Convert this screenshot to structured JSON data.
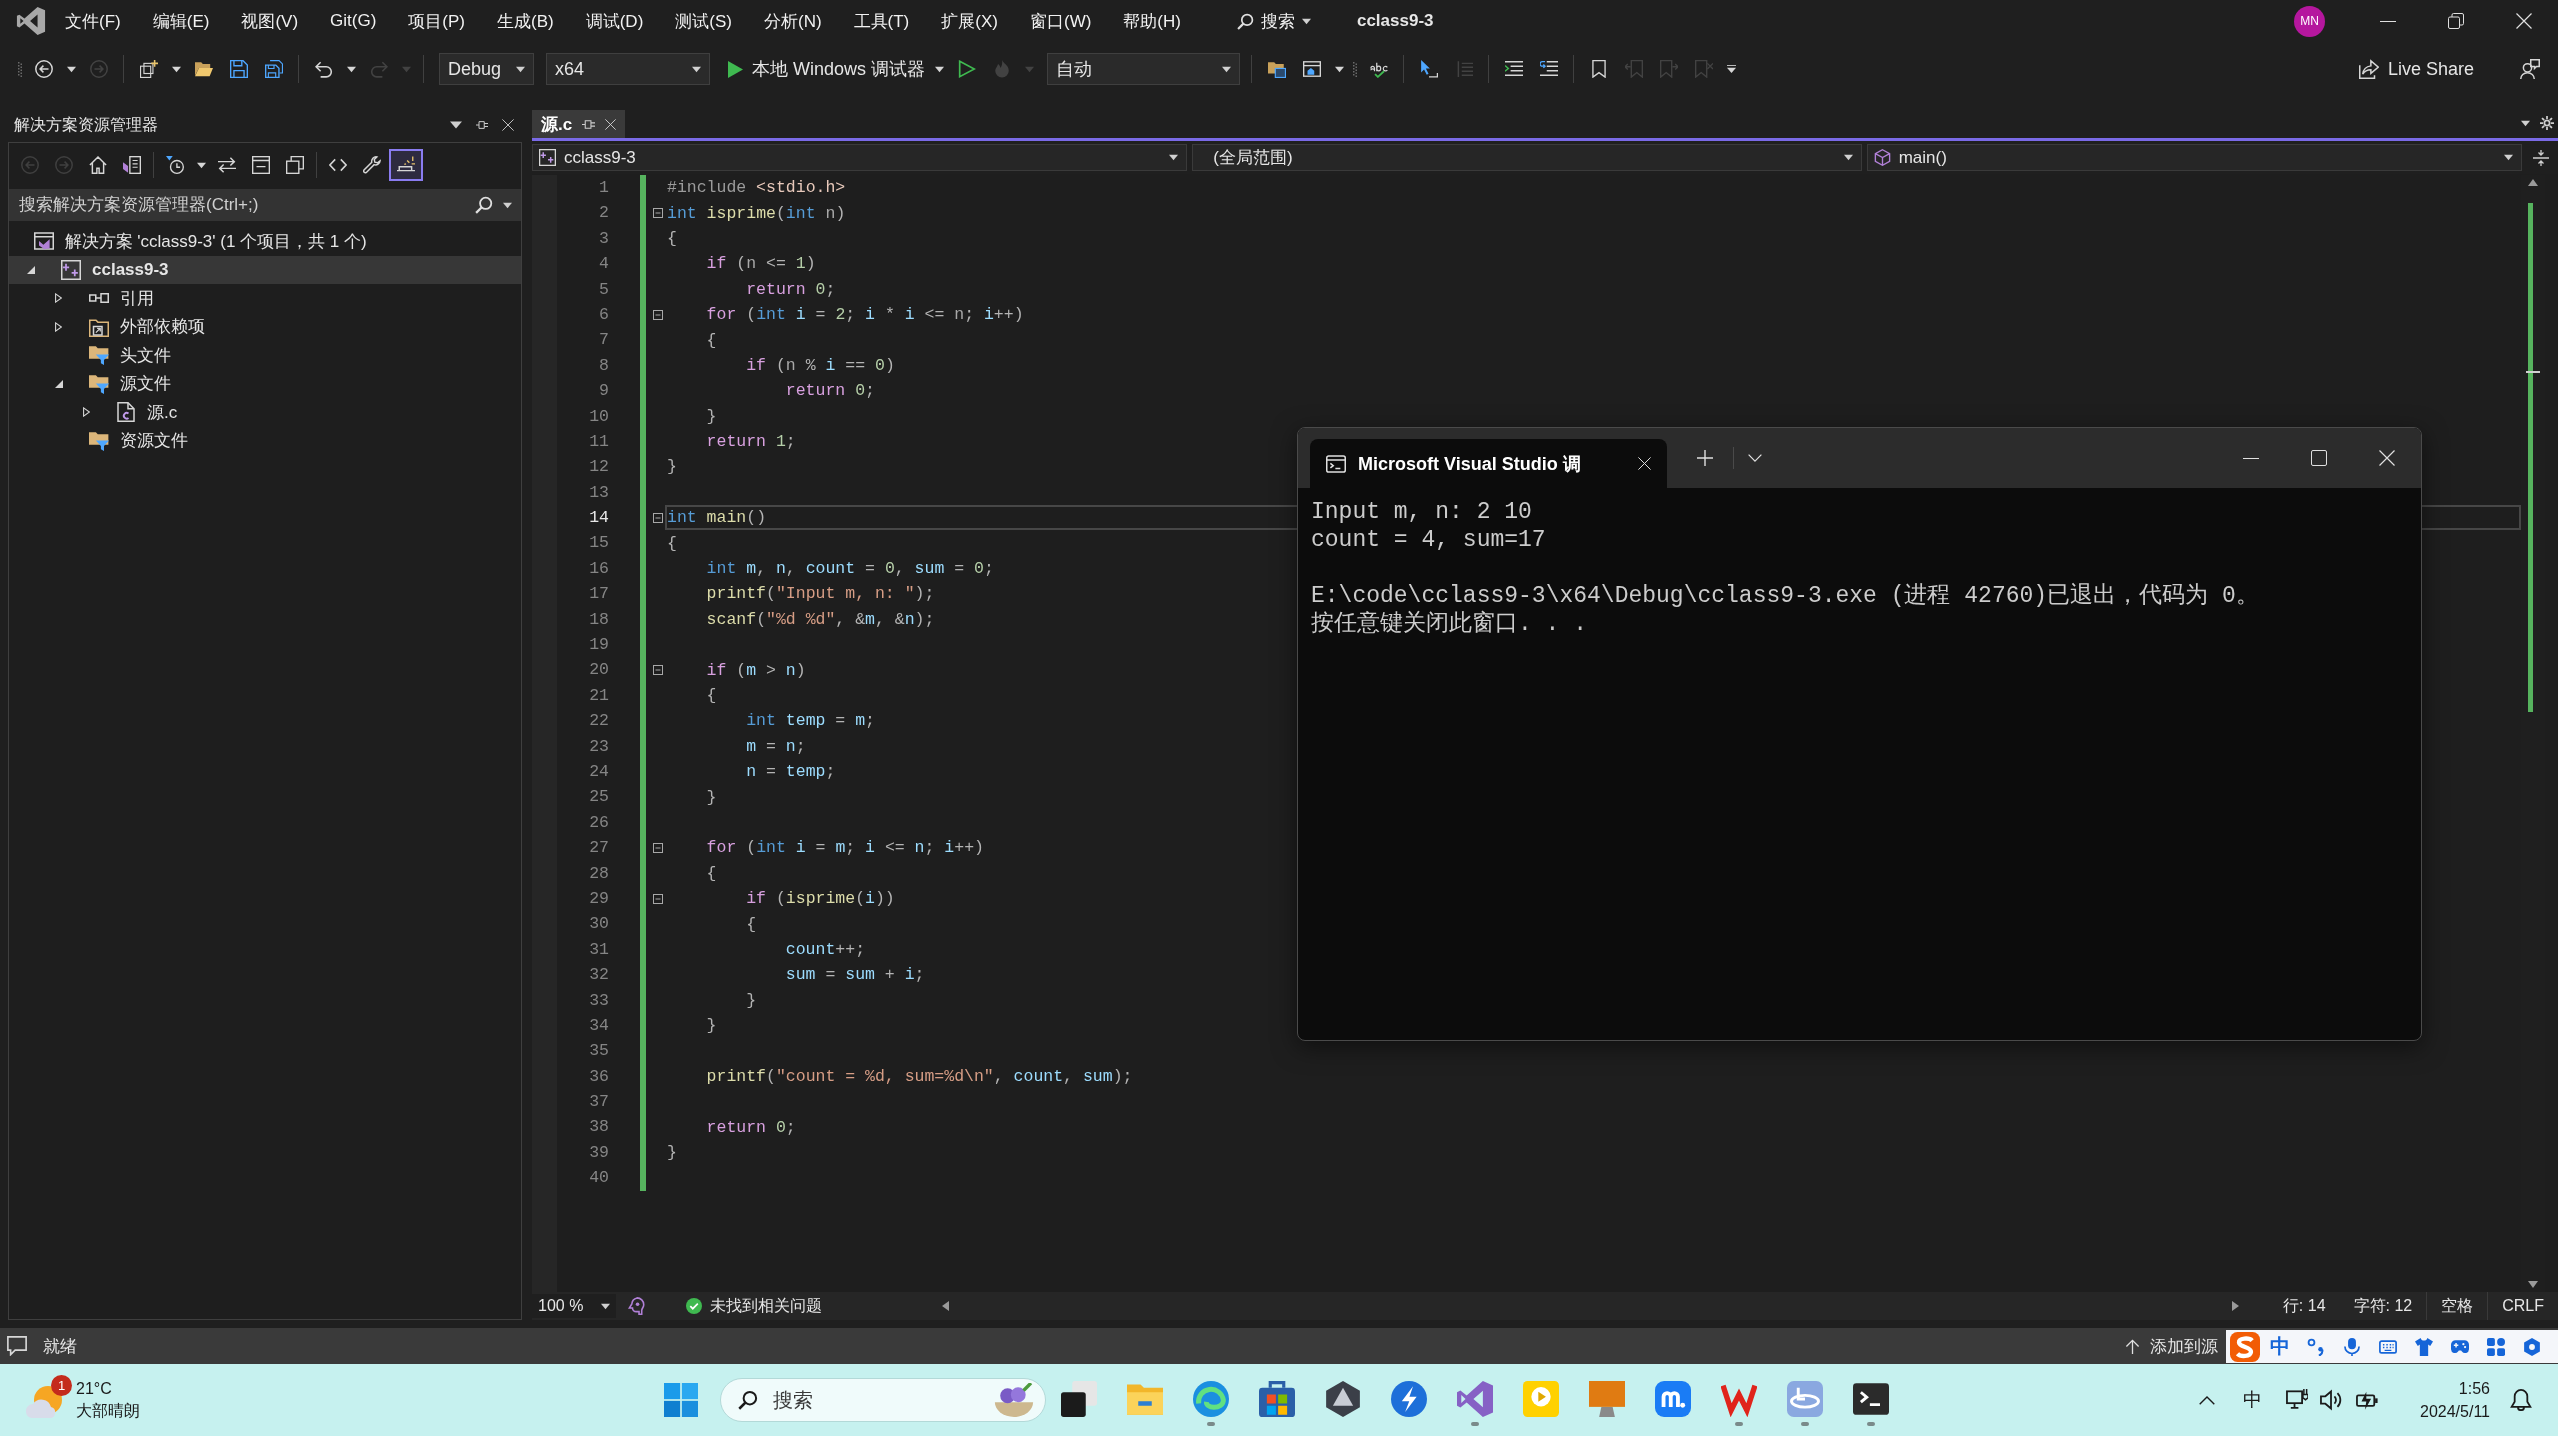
{
  "menu_bar": {
    "items": [
      "文件(F)",
      "编辑(E)",
      "视图(V)",
      "Git(G)",
      "项目(P)",
      "生成(B)",
      "调试(D)",
      "测试(S)",
      "分析(N)",
      "工具(T)",
      "扩展(X)",
      "窗口(W)",
      "帮助(H)"
    ],
    "search": "搜索",
    "solution": "cclass9-3",
    "account": "MN"
  },
  "toolbar": {
    "groups": [
      {
        "items": [
          {
            "kind": "grip",
            "disabled": false
          },
          {
            "kind": "back",
            "disabled": false
          },
          {
            "kind": "dropdown",
            "disabled": false
          },
          {
            "kind": "forward",
            "disabled": true
          }
        ]
      },
      {
        "items": [
          {
            "kind": "new-item",
            "disabled": false
          },
          {
            "kind": "dropdown",
            "disabled": false
          },
          {
            "kind": "open",
            "disabled": false
          },
          {
            "kind": "save",
            "disabled": false
          },
          {
            "kind": "save-all",
            "disabled": false
          }
        ]
      },
      {
        "items": [
          {
            "kind": "undo",
            "disabled": false
          },
          {
            "kind": "dropdown",
            "disabled": false
          },
          {
            "kind": "redo",
            "disabled": true
          },
          {
            "kind": "dropdown",
            "disabled": true
          }
        ]
      },
      {
        "items": [
          {
            "kind": "configuration-select",
            "value": "Debug",
            "disabled": false
          },
          {
            "kind": "platform-select",
            "value": "x64",
            "disabled": false
          },
          {
            "kind": "run",
            "label": "本地 Windows 调试器",
            "disabled": false
          },
          {
            "kind": "dropdown",
            "disabled": false
          },
          {
            "kind": "run-outline",
            "disabled": false
          },
          {
            "kind": "hot-reload",
            "disabled": true
          },
          {
            "kind": "dropdown",
            "disabled": true
          },
          {
            "kind": "mode-select",
            "value": "自动",
            "disabled": false
          }
        ]
      },
      {
        "items": [
          {
            "kind": "browse",
            "disabled": false
          },
          {
            "kind": "window",
            "disabled": false
          },
          {
            "kind": "dropdown",
            "disabled": false
          },
          {
            "kind": "grip",
            "disabled": false
          },
          {
            "kind": "spellcheck",
            "disabled": false
          }
        ]
      },
      {
        "items": [
          {
            "kind": "cursor",
            "disabled": false
          },
          {
            "kind": "column",
            "disabled": true
          }
        ]
      },
      {
        "items": [
          {
            "kind": "comment",
            "disabled": false
          },
          {
            "kind": "uncomment",
            "disabled": false
          }
        ]
      },
      {
        "items": [
          {
            "kind": "bookmark",
            "disabled": false
          },
          {
            "kind": "bookmark-prev",
            "disabled": true
          },
          {
            "kind": "bookmark-next",
            "disabled": true
          },
          {
            "kind": "bookmark-clear",
            "disabled": true
          },
          {
            "kind": "overflow",
            "disabled": false
          }
        ]
      }
    ],
    "live_share": "Live Share"
  },
  "solution_explorer": {
    "title": "解决方案资源管理器",
    "toolbar": {
      "groups": [
        {
          "items": [
            {
              "kind": "back",
              "disabled": true,
              "on": false
            },
            {
              "kind": "forward",
              "disabled": true,
              "on": false
            },
            {
              "kind": "home",
              "disabled": false,
              "on": false
            },
            {
              "kind": "switch-views",
              "disabled": false,
              "on": false
            }
          ]
        },
        {
          "items": [
            {
              "kind": "pending-changes",
              "disabled": false,
              "on": false
            },
            {
              "kind": "dropdown",
              "disabled": false,
              "on": false
            },
            {
              "kind": "sync",
              "disabled": false,
              "on": false
            },
            {
              "kind": "collapse-all",
              "disabled": false,
              "on": false
            },
            {
              "kind": "show-all",
              "disabled": false,
              "on": false
            }
          ]
        },
        {
          "items": [
            {
              "kind": "code",
              "disabled": false,
              "on": false
            },
            {
              "kind": "properties",
              "disabled": false,
              "on": false
            },
            {
              "kind": "preview",
              "disabled": false,
              "on": true
            }
          ]
        }
      ]
    },
    "search": {
      "placeholder": "搜索解决方案资源管理器(Ctrl+;)"
    },
    "tree": [
      {
        "label": "解决方案 'cclass9-3' (1 个项目，共 1 个)",
        "kind": "solution",
        "selected": false,
        "children": [
          {
            "label": "cclass9-3",
            "kind": "project",
            "expanded": true,
            "selected": true,
            "children": [
              {
                "label": "引用",
                "kind": "references",
                "expanded": false,
                "selected": false
              },
              {
                "label": "外部依赖项",
                "kind": "dependencies",
                "expanded": false,
                "selected": false
              },
              {
                "label": "头文件",
                "kind": "filter",
                "selected": false
              },
              {
                "label": "源文件",
                "kind": "filter",
                "expanded": true,
                "selected": false,
                "children": [
                  {
                    "label": "源.c",
                    "kind": "c-file",
                    "expanded": false,
                    "selected": false
                  }
                ]
              },
              {
                "label": "资源文件",
                "kind": "filter",
                "selected": false
              }
            ]
          }
        ]
      }
    ]
  },
  "editor": {
    "tabs": [
      {
        "label": "源.c",
        "selected": true
      }
    ],
    "navigation": {
      "project": "cclass9-3",
      "scope": "(全局范围)",
      "member": "main()"
    },
    "lines": [
      {
        "number": "1",
        "changed": true,
        "fold": false,
        "selected": false,
        "tokens": [
          {
            "kind": "preproc",
            "text": "#include"
          },
          {
            "kind": "include",
            "text": " <stdio.h>"
          }
        ]
      },
      {
        "number": "2",
        "changed": true,
        "fold": true,
        "selected": false,
        "tokens": [
          {
            "kind": "keyword",
            "text": "int"
          },
          {
            "kind": "function",
            "text": " isprime"
          },
          {
            "kind": "punct",
            "text": "("
          },
          {
            "kind": "keyword",
            "text": "int"
          },
          {
            "kind": "param",
            "text": " n"
          },
          {
            "kind": "punct",
            "text": ")"
          }
        ]
      },
      {
        "number": "3",
        "changed": true,
        "fold": false,
        "selected": false,
        "tokens": [
          {
            "kind": "punct",
            "text": "{"
          }
        ]
      },
      {
        "number": "4",
        "changed": true,
        "fold": false,
        "selected": false,
        "tokens": [
          {
            "kind": "control",
            "text": "    if"
          },
          {
            "kind": "punct",
            "text": " ("
          },
          {
            "kind": "param",
            "text": "n"
          },
          {
            "kind": "punct",
            "text": " <= "
          },
          {
            "kind": "number",
            "text": "1"
          },
          {
            "kind": "punct",
            "text": ")"
          }
        ]
      },
      {
        "number": "5",
        "changed": true,
        "fold": false,
        "selected": false,
        "tokens": [
          {
            "kind": "control",
            "text": "        return"
          },
          {
            "kind": "number",
            "text": " 0"
          },
          {
            "kind": "punct",
            "text": ";"
          }
        ]
      },
      {
        "number": "6",
        "changed": true,
        "fold": true,
        "selected": false,
        "tokens": [
          {
            "kind": "control",
            "text": "    for"
          },
          {
            "kind": "punct",
            "text": " ("
          },
          {
            "kind": "keyword",
            "text": "int"
          },
          {
            "kind": "local",
            "text": " i"
          },
          {
            "kind": "punct",
            "text": " = "
          },
          {
            "kind": "number",
            "text": "2"
          },
          {
            "kind": "punct",
            "text": "; "
          },
          {
            "kind": "local",
            "text": "i"
          },
          {
            "kind": "punct",
            "text": " * "
          },
          {
            "kind": "local",
            "text": "i"
          },
          {
            "kind": "punct",
            "text": " <= "
          },
          {
            "kind": "param",
            "text": "n"
          },
          {
            "kind": "punct",
            "text": "; "
          },
          {
            "kind": "local",
            "text": "i"
          },
          {
            "kind": "punct",
            "text": "++)"
          }
        ]
      },
      {
        "number": "7",
        "changed": true,
        "fold": false,
        "selected": false,
        "tokens": [
          {
            "kind": "punct",
            "text": "    {"
          }
        ]
      },
      {
        "number": "8",
        "changed": true,
        "fold": false,
        "selected": false,
        "tokens": [
          {
            "kind": "control",
            "text": "        if"
          },
          {
            "kind": "punct",
            "text": " ("
          },
          {
            "kind": "param",
            "text": "n"
          },
          {
            "kind": "punct",
            "text": " % "
          },
          {
            "kind": "local",
            "text": "i"
          },
          {
            "kind": "punct",
            "text": " == "
          },
          {
            "kind": "number",
            "text": "0"
          },
          {
            "kind": "punct",
            "text": ")"
          }
        ]
      },
      {
        "number": "9",
        "changed": true,
        "fold": false,
        "selected": false,
        "tokens": [
          {
            "kind": "control",
            "text": "            return"
          },
          {
            "kind": "number",
            "text": " 0"
          },
          {
            "kind": "punct",
            "text": ";"
          }
        ]
      },
      {
        "number": "10",
        "changed": true,
        "fold": false,
        "selected": false,
        "tokens": [
          {
            "kind": "punct",
            "text": "    }"
          }
        ]
      },
      {
        "number": "11",
        "changed": true,
        "fold": false,
        "selected": false,
        "tokens": [
          {
            "kind": "control",
            "text": "    return"
          },
          {
            "kind": "number",
            "text": " 1"
          },
          {
            "kind": "punct",
            "text": ";"
          }
        ]
      },
      {
        "number": "12",
        "changed": true,
        "fold": false,
        "selected": false,
        "tokens": [
          {
            "kind": "punct",
            "text": "}"
          }
        ]
      },
      {
        "number": "13",
        "changed": true,
        "fold": false,
        "selected": false
      },
      {
        "number": "14",
        "changed": true,
        "fold": true,
        "selected": true,
        "tokens": [
          {
            "kind": "keyword",
            "text": "int"
          },
          {
            "kind": "function",
            "text": " main"
          },
          {
            "kind": "punct",
            "text": "()"
          }
        ]
      },
      {
        "number": "15",
        "changed": true,
        "fold": false,
        "selected": false,
        "tokens": [
          {
            "kind": "punct",
            "text": "{"
          }
        ]
      },
      {
        "number": "16",
        "changed": true,
        "fold": false,
        "selected": false,
        "tokens": [
          {
            "kind": "keyword",
            "text": "    int"
          },
          {
            "kind": "local",
            "text": " m"
          },
          {
            "kind": "punct",
            "text": ", "
          },
          {
            "kind": "local",
            "text": "n"
          },
          {
            "kind": "punct",
            "text": ", "
          },
          {
            "kind": "local",
            "text": "count"
          },
          {
            "kind": "punct",
            "text": " = "
          },
          {
            "kind": "number",
            "text": "0"
          },
          {
            "kind": "punct",
            "text": ", "
          },
          {
            "kind": "local",
            "text": "sum"
          },
          {
            "kind": "punct",
            "text": " = "
          },
          {
            "kind": "number",
            "text": "0"
          },
          {
            "kind": "punct",
            "text": ";"
          }
        ]
      },
      {
        "number": "17",
        "changed": true,
        "fold": false,
        "selected": false,
        "tokens": [
          {
            "kind": "function",
            "text": "    printf"
          },
          {
            "kind": "punct",
            "text": "("
          },
          {
            "kind": "string",
            "text": "\"Input m, n: \""
          },
          {
            "kind": "punct",
            "text": ");"
          }
        ]
      },
      {
        "number": "18",
        "changed": true,
        "fold": false,
        "selected": false,
        "tokens": [
          {
            "kind": "function",
            "text": "    scanf"
          },
          {
            "kind": "punct",
            "text": "("
          },
          {
            "kind": "string",
            "text": "\"%d %d\""
          },
          {
            "kind": "punct",
            "text": ", &"
          },
          {
            "kind": "local",
            "text": "m"
          },
          {
            "kind": "punct",
            "text": ", &"
          },
          {
            "kind": "local",
            "text": "n"
          },
          {
            "kind": "punct",
            "text": ");"
          }
        ]
      },
      {
        "number": "19",
        "changed": true,
        "fold": false,
        "selected": false
      },
      {
        "number": "20",
        "changed": true,
        "fold": true,
        "selected": false,
        "tokens": [
          {
            "kind": "control",
            "text": "    if"
          },
          {
            "kind": "punct",
            "text": " ("
          },
          {
            "kind": "local",
            "text": "m"
          },
          {
            "kind": "punct",
            "text": " > "
          },
          {
            "kind": "local",
            "text": "n"
          },
          {
            "kind": "punct",
            "text": ")"
          }
        ]
      },
      {
        "number": "21",
        "changed": true,
        "fold": false,
        "selected": false,
        "tokens": [
          {
            "kind": "punct",
            "text": "    {"
          }
        ]
      },
      {
        "number": "22",
        "changed": true,
        "fold": false,
        "selected": false,
        "tokens": [
          {
            "kind": "keyword",
            "text": "        int"
          },
          {
            "kind": "local",
            "text": " temp"
          },
          {
            "kind": "punct",
            "text": " = "
          },
          {
            "kind": "local",
            "text": "m"
          },
          {
            "kind": "punct",
            "text": ";"
          }
        ]
      },
      {
        "number": "23",
        "changed": true,
        "fold": false,
        "selected": false,
        "tokens": [
          {
            "kind": "local",
            "text": "        m"
          },
          {
            "kind": "punct",
            "text": " = "
          },
          {
            "kind": "local",
            "text": "n"
          },
          {
            "kind": "punct",
            "text": ";"
          }
        ]
      },
      {
        "number": "24",
        "changed": true,
        "fold": false,
        "selected": false,
        "tokens": [
          {
            "kind": "local",
            "text": "        n"
          },
          {
            "kind": "punct",
            "text": " = "
          },
          {
            "kind": "local",
            "text": "temp"
          },
          {
            "kind": "punct",
            "text": ";"
          }
        ]
      },
      {
        "number": "25",
        "changed": true,
        "fold": false,
        "selected": false,
        "tokens": [
          {
            "kind": "punct",
            "text": "    }"
          }
        ]
      },
      {
        "number": "26",
        "changed": true,
        "fold": false,
        "selected": false
      },
      {
        "number": "27",
        "changed": true,
        "fold": true,
        "selected": false,
        "tokens": [
          {
            "kind": "control",
            "text": "    for"
          },
          {
            "kind": "punct",
            "text": " ("
          },
          {
            "kind": "keyword",
            "text": "int"
          },
          {
            "kind": "local",
            "text": " i"
          },
          {
            "kind": "punct",
            "text": " = "
          },
          {
            "kind": "local",
            "text": "m"
          },
          {
            "kind": "punct",
            "text": "; "
          },
          {
            "kind": "local",
            "text": "i"
          },
          {
            "kind": "punct",
            "text": " <= "
          },
          {
            "kind": "local",
            "text": "n"
          },
          {
            "kind": "punct",
            "text": "; "
          },
          {
            "kind": "local",
            "text": "i"
          },
          {
            "kind": "punct",
            "text": "++)"
          }
        ]
      },
      {
        "number": "28",
        "changed": true,
        "fold": false,
        "selected": false,
        "tokens": [
          {
            "kind": "punct",
            "text": "    {"
          }
        ]
      },
      {
        "number": "29",
        "changed": true,
        "fold": true,
        "selected": false,
        "tokens": [
          {
            "kind": "control",
            "text": "        if"
          },
          {
            "kind": "punct",
            "text": " ("
          },
          {
            "kind": "function",
            "text": "isprime"
          },
          {
            "kind": "punct",
            "text": "("
          },
          {
            "kind": "local",
            "text": "i"
          },
          {
            "kind": "punct",
            "text": "))"
          }
        ]
      },
      {
        "number": "30",
        "changed": true,
        "fold": false,
        "selected": false,
        "tokens": [
          {
            "kind": "punct",
            "text": "        {"
          }
        ]
      },
      {
        "number": "31",
        "changed": true,
        "fold": false,
        "selected": false,
        "tokens": [
          {
            "kind": "local",
            "text": "            count"
          },
          {
            "kind": "punct",
            "text": "++;"
          }
        ]
      },
      {
        "number": "32",
        "changed": true,
        "fold": false,
        "selected": false,
        "tokens": [
          {
            "kind": "local",
            "text": "            sum"
          },
          {
            "kind": "punct",
            "text": " = "
          },
          {
            "kind": "local",
            "text": "sum"
          },
          {
            "kind": "punct",
            "text": " + "
          },
          {
            "kind": "local",
            "text": "i"
          },
          {
            "kind": "punct",
            "text": ";"
          }
        ]
      },
      {
        "number": "33",
        "changed": true,
        "fold": false,
        "selected": false,
        "tokens": [
          {
            "kind": "punct",
            "text": "        }"
          }
        ]
      },
      {
        "number": "34",
        "changed": true,
        "fold": false,
        "selected": false,
        "tokens": [
          {
            "kind": "punct",
            "text": "    }"
          }
        ]
      },
      {
        "number": "35",
        "changed": true,
        "fold": false,
        "selected": false
      },
      {
        "number": "36",
        "changed": true,
        "fold": false,
        "selected": false,
        "tokens": [
          {
            "kind": "function",
            "text": "    printf"
          },
          {
            "kind": "punct",
            "text": "("
          },
          {
            "kind": "string",
            "text": "\"count = %d, sum=%d\\n\""
          },
          {
            "kind": "punct",
            "text": ", "
          },
          {
            "kind": "local",
            "text": "count"
          },
          {
            "kind": "punct",
            "text": ", "
          },
          {
            "kind": "local",
            "text": "sum"
          },
          {
            "kind": "punct",
            "text": ");"
          }
        ]
      },
      {
        "number": "37",
        "changed": true,
        "fold": false,
        "selected": false
      },
      {
        "number": "38",
        "changed": true,
        "fold": false,
        "selected": false,
        "tokens": [
          {
            "kind": "control",
            "text": "    return"
          },
          {
            "kind": "number",
            "text": " 0"
          },
          {
            "kind": "punct",
            "text": ";"
          }
        ]
      },
      {
        "number": "39",
        "changed": true,
        "fold": false,
        "selected": false,
        "tokens": [
          {
            "kind": "punct",
            "text": "}"
          }
        ]
      },
      {
        "number": "40",
        "changed": true,
        "fold": false,
        "selected": false
      }
    ],
    "status": {
      "zoom": "100 %",
      "issues": "未找到相关问题",
      "line": "行: 14",
      "column": "字符: 12",
      "indentation": "空格",
      "line_ending": "CRLF"
    }
  },
  "console": {
    "title": "Microsoft Visual Studio 调",
    "output": [
      {
        "lines": [
          "Input m, n: 2 10",
          "count = 4, sum=17"
        ]
      },
      {
        "lines": [
          "E:\\code\\cclass9-3\\x64\\Debug\\cclass9-3.exe (进程 42760)已退出，代码为 0。",
          "按任意键关闭此窗口. . ."
        ]
      }
    ]
  },
  "status_bar": {
    "text": "就绪",
    "source_control": "添加到源"
  },
  "input_method": {
    "mode": "中"
  },
  "taskbar": {
    "weather": {
      "temperature": "21°C",
      "condition": "大部晴朗",
      "badge": "1"
    },
    "search": {
      "placeholder": "搜索"
    },
    "apps": [
      {
        "kind": "task-view",
        "running": false
      },
      {
        "kind": "file-explorer",
        "running": false
      },
      {
        "kind": "browser",
        "running": true
      },
      {
        "kind": "store",
        "running": false
      },
      {
        "kind": "cube",
        "running": false
      },
      {
        "kind": "bolt",
        "running": false
      },
      {
        "kind": "ide",
        "running": true
      },
      {
        "kind": "player",
        "running": false
      },
      {
        "kind": "monitor",
        "running": false
      },
      {
        "kind": "wave",
        "running": false
      },
      {
        "kind": "office",
        "running": true
      },
      {
        "kind": "emulator",
        "running": true
      },
      {
        "kind": "terminal",
        "running": true
      }
    ],
    "tray": {
      "input_mode": "中",
      "time": "1:56",
      "date": "2024/5/11"
    }
  }
}
